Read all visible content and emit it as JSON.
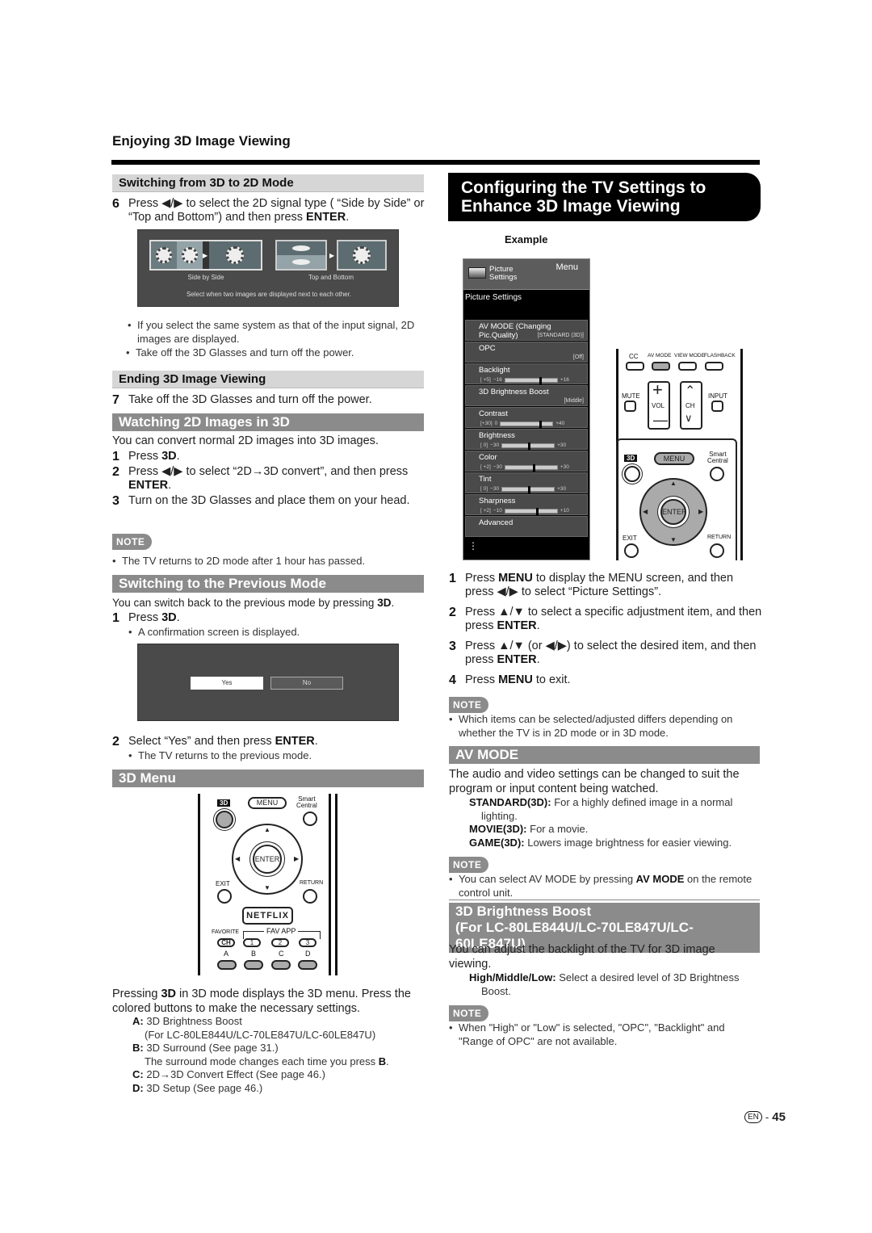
{
  "page": {
    "header": "Enjoying 3D Image Viewing",
    "footer": {
      "lang_badge": "EN",
      "sep": "-",
      "page_number": "45"
    }
  },
  "left": {
    "switch_3d_2d": {
      "heading": "Switching from 3D to 2D Mode",
      "step6": {
        "num": "6",
        "text_a": "Press ◀/▶ to select the 2D signal type ( “Side by Side” or “Top and Bottom”) and then press ",
        "bold": "ENTER",
        "text_b": "."
      },
      "screen": {
        "option1": "Side by Side",
        "option2": "Top and Bottom",
        "caption": "Select when two images are displayed next to each other."
      },
      "bullets": [
        "If you select the same system as that of the input signal, 2D images are displayed.",
        "Take off the 3D Glasses and turn off the power."
      ]
    },
    "ending": {
      "heading": "Ending 3D Image Viewing",
      "step7": {
        "num": "7",
        "text": "Take off the 3D Glasses and turn off the power."
      }
    },
    "watching": {
      "heading": "Watching 2D Images in 3D",
      "intro": "You can convert normal 2D images into 3D images.",
      "step1": {
        "num": "1",
        "text": "Press ",
        "bold": "3D",
        "after": "."
      },
      "step2": {
        "num": "2",
        "text": "Press ◀/▶ to select “2D→3D convert”, and then press ",
        "bold": "ENTER",
        "after": "."
      },
      "step3": {
        "num": "3",
        "text": "Turn on the 3D Glasses and place them on your head."
      },
      "note_label": "NOTE",
      "note": "The TV returns to 2D mode after 1 hour has passed."
    },
    "previous": {
      "heading": "Switching to the Previous Mode",
      "intro": "You can switch back to the previous mode by pressing ",
      "intro_bold": "3D",
      "intro_after": ".",
      "step1": {
        "num": "1",
        "text": "Press ",
        "bold": "3D",
        "after": "."
      },
      "step1_bullet": "A confirmation screen is displayed.",
      "dialog": {
        "yes": "Yes",
        "no": "No"
      },
      "step2": {
        "num": "2",
        "text": "Select “Yes” and then press ",
        "bold": "ENTER",
        "after": "."
      },
      "step2_bullet": "The TV returns to the previous mode."
    },
    "menu3d": {
      "heading": "3D Menu",
      "remote": {
        "btn_3d": "3D",
        "menu": "MENU",
        "smart": "Smart",
        "central": "Central",
        "enter": "ENTER",
        "exit": "EXIT",
        "return": "RETURN",
        "netflix": "NETFLIX",
        "favorite": "FAVORITE",
        "fav_app": "FAV APP",
        "ch": "CH",
        "n1": "1",
        "n2": "2",
        "n3": "3",
        "a": "A",
        "b": "B",
        "c": "C",
        "d": "D"
      },
      "desc_a": "Pressing ",
      "desc_bold": "3D",
      "desc_b": " in 3D mode displays the 3D menu. Press the colored buttons to make the necessary settings.",
      "items": [
        {
          "key": "A:",
          "text": "3D Brightness Boost"
        },
        {
          "key": "",
          "text": "(For LC-80LE844U/LC-70LE847U/LC-60LE847U)"
        },
        {
          "key": "B:",
          "text": "3D Surround (See page 31.)"
        },
        {
          "key": "",
          "text": "The surround mode changes each time you press ",
          "bold": "B",
          "after": "."
        },
        {
          "key": "C:",
          "text": "2D→3D Convert Effect (See page 46.)"
        },
        {
          "key": "D:",
          "text": "3D Setup (See page 46.)"
        }
      ]
    }
  },
  "right": {
    "banner": {
      "line1": "Configuring the TV Settings to",
      "line2": "Enhance 3D Image Viewing"
    },
    "example_label": "Example",
    "menu": {
      "icon_label_1": "Picture",
      "icon_label_2": "Settings",
      "menu_label": "Menu",
      "section": "Picture Settings",
      "items": [
        {
          "label": "AV MODE (Changing Pic.Quality)",
          "value": "[STANDARD (3D)]"
        },
        {
          "label": "OPC",
          "value": "[Off]"
        },
        {
          "label": "Backlight",
          "current": "[ +5]",
          "min": "−16",
          "max": "+16",
          "fraction": 0.66
        },
        {
          "label": "3D Brightness Boost",
          "value": "[Middle]"
        },
        {
          "label": "Contrast",
          "current": "[+30]",
          "min": "0",
          "max": "+40",
          "fraction": 0.75
        },
        {
          "label": "Brightness",
          "current": "[  0]",
          "min": "−30",
          "max": "+30",
          "fraction": 0.5
        },
        {
          "label": "Color",
          "current": "[ +2]",
          "min": "−30",
          "max": "+30",
          "fraction": 0.53
        },
        {
          "label": "Tint",
          "current": "[  0]",
          "min": "−30",
          "max": "+30",
          "fraction": 0.5
        },
        {
          "label": "Sharpness",
          "current": "[ +2]",
          "min": "−10",
          "max": "+10",
          "fraction": 0.6
        },
        {
          "label": "Advanced",
          "value": ""
        }
      ],
      "more": "⋮"
    },
    "remote": {
      "cc": "CC",
      "av_mode": "AV MODE",
      "view_mode": "VIEW MODE",
      "flashback": "FLASHBACK",
      "mute": "MUTE",
      "vol": "VOL",
      "ch": "CH",
      "input": "INPUT",
      "btn_3d": "3D",
      "menu": "MENU",
      "smart": "Smart",
      "central": "Central",
      "enter": "ENTER",
      "exit": "EXIT",
      "return": "RETURN"
    },
    "steps": [
      {
        "num": "1",
        "a": "Press ",
        "b": "MENU",
        "c": " to display the MENU screen, and then press ◀/▶ to select “Picture Settings”."
      },
      {
        "num": "2",
        "a": "Press ▲/▼ to select a specific adjustment item, and then press ",
        "b": "ENTER",
        "c": "."
      },
      {
        "num": "3",
        "a": "Press ▲/▼ (or ◀/▶) to select the desired item, and then press ",
        "b": "ENTER",
        "c": "."
      },
      {
        "num": "4",
        "a": "Press ",
        "b": "MENU",
        "c": " to exit."
      }
    ],
    "note1_label": "NOTE",
    "note1": "Which items can be selected/adjusted differs depending on whether the TV is in 2D mode or in 3D mode.",
    "av_mode": {
      "heading": "AV MODE",
      "intro": "The audio and video settings can be changed to suit the program or input content being watched.",
      "items": [
        {
          "key": "STANDARD(3D):",
          "text": "For a highly defined image in a normal lighting."
        },
        {
          "key": "MOVIE(3D):",
          "text": "For a movie."
        },
        {
          "key": "GAME(3D):",
          "text": "Lowers image brightness for easier viewing."
        }
      ],
      "note_label": "NOTE",
      "note_a": "You can select AV MODE by pressing ",
      "note_bold": "AV MODE",
      "note_b": " on the remote control unit."
    },
    "boost": {
      "heading1": "3D Brightness Boost",
      "heading2": "(For LC-80LE844U/LC-70LE847U/LC-60LE847U)",
      "intro": "You can adjust the backlight of the TV for 3D image viewing.",
      "item_key": "High/Middle/Low:",
      "item_text": "Select a desired level of 3D Brightness Boost.",
      "note_label": "NOTE",
      "note": "When \"High\" or \"Low\" is selected, \"OPC\", \"Backlight\" and \"Range of OPC\" are not available."
    }
  }
}
